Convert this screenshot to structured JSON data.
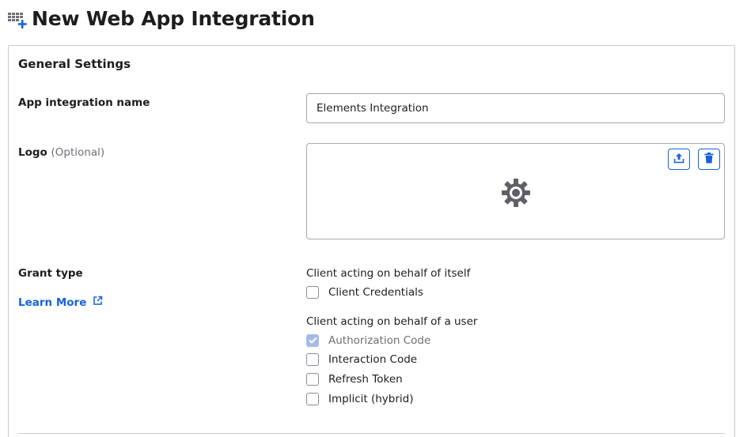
{
  "header": {
    "title": "New Web App Integration",
    "icon": "grid-plus-icon"
  },
  "general_settings": {
    "title": "General Settings",
    "app_name": {
      "label": "App integration name",
      "value": "Elements Integration"
    },
    "logo": {
      "label": "Logo",
      "optional_text": "(Optional)",
      "upload_icon": "upload-icon",
      "delete_icon": "trash-icon",
      "placeholder_icon": "gear-icon"
    },
    "grant_type": {
      "label": "Grant type",
      "learn_more": "Learn More",
      "groups": [
        {
          "heading": "Client acting on behalf of itself",
          "options": [
            {
              "label": "Client Credentials",
              "checked": false,
              "disabled": false
            }
          ]
        },
        {
          "heading": "Client acting on behalf of a user",
          "options": [
            {
              "label": "Authorization Code",
              "checked": true,
              "disabled": true
            },
            {
              "label": "Interaction Code",
              "checked": false,
              "disabled": false
            },
            {
              "label": "Refresh Token",
              "checked": false,
              "disabled": false
            },
            {
              "label": "Implicit (hybrid)",
              "checked": false,
              "disabled": false
            }
          ]
        }
      ]
    }
  },
  "colors": {
    "accent": "#1662dd",
    "border": "#c9cbd1",
    "checked_disabled": "#a4b9e8",
    "muted_text": "#6e6e78"
  }
}
